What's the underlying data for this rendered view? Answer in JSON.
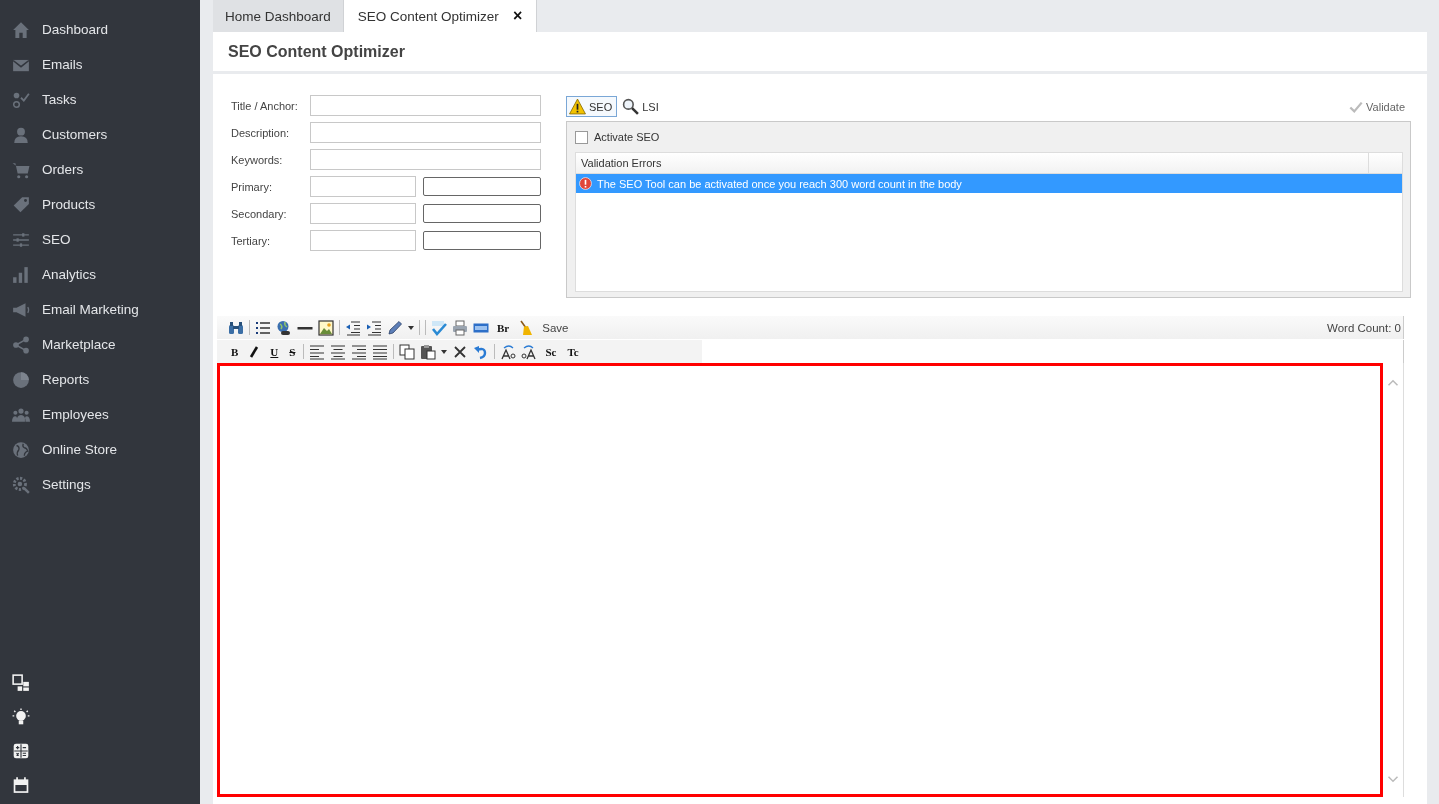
{
  "sidebar": {
    "items": [
      {
        "label": "Dashboard"
      },
      {
        "label": "Emails"
      },
      {
        "label": "Tasks"
      },
      {
        "label": "Customers"
      },
      {
        "label": "Orders"
      },
      {
        "label": "Products"
      },
      {
        "label": "SEO"
      },
      {
        "label": "Analytics"
      },
      {
        "label": "Email Marketing"
      },
      {
        "label": "Marketplace"
      },
      {
        "label": "Reports"
      },
      {
        "label": "Employees"
      },
      {
        "label": "Online Store"
      },
      {
        "label": "Settings"
      }
    ]
  },
  "tabs": [
    {
      "label": "Home Dashboard",
      "selected": false
    },
    {
      "label": "SEO Content Optimizer",
      "selected": true,
      "close": "×"
    }
  ],
  "page_title": "SEO Content Optimizer",
  "form": {
    "fields": [
      {
        "label": "Title / Anchor:",
        "kind": "single"
      },
      {
        "label": "Description:",
        "kind": "single"
      },
      {
        "label": "Keywords:",
        "kind": "single"
      },
      {
        "label": "Primary:",
        "kind": "pair"
      },
      {
        "label": "Secondary:",
        "kind": "pair"
      },
      {
        "label": "Tertiary:",
        "kind": "pair"
      }
    ]
  },
  "seo_panel": {
    "tabs": [
      {
        "label": "SEO",
        "selected": true
      },
      {
        "label": "LSI",
        "selected": false
      }
    ],
    "validate": {
      "label": "Validate",
      "disabled": true
    },
    "activate": {
      "label": "Activate SEO",
      "checked": false
    },
    "grid": {
      "columns": [
        "Validation Errors"
      ],
      "rows": [
        {
          "message": "The SEO Tool can be activated once you reach 300 word count in the body",
          "selected": true
        }
      ]
    }
  },
  "editor": {
    "toolbar": [
      [
        {
          "kind": "icon"
        },
        {
          "kind": "separator"
        },
        {
          "kind": "icon"
        },
        {
          "kind": "icon"
        },
        {
          "kind": "icon"
        },
        {
          "kind": "icon"
        },
        {
          "kind": "separator"
        },
        {
          "kind": "icon"
        },
        {
          "kind": "icon"
        },
        {
          "kind": "icon"
        },
        {
          "kind": "caret"
        },
        {
          "kind": "separator"
        },
        {
          "kind": "separator"
        },
        {
          "kind": "icon"
        },
        {
          "kind": "icon"
        },
        {
          "kind": "icon"
        },
        {
          "kind": "text",
          "text": "Br"
        },
        {
          "kind": "icon"
        },
        {
          "kind": "button",
          "text": "Save"
        }
      ],
      [
        {
          "kind": "text",
          "text": "B"
        },
        {
          "kind": "icon"
        },
        {
          "kind": "underlined",
          "text": "U"
        },
        {
          "kind": "struck",
          "text": "S"
        },
        {
          "kind": "separator"
        },
        {
          "kind": "icon"
        },
        {
          "kind": "icon"
        },
        {
          "kind": "icon"
        },
        {
          "kind": "icon"
        },
        {
          "kind": "separator"
        },
        {
          "kind": "icon"
        },
        {
          "kind": "icon"
        },
        {
          "kind": "caret"
        },
        {
          "kind": "icon"
        },
        {
          "kind": "icon"
        },
        {
          "kind": "separator"
        },
        {
          "kind": "icon"
        },
        {
          "kind": "icon"
        },
        {
          "kind": "text",
          "text": "Sc"
        },
        {
          "kind": "text",
          "text": "Tc"
        }
      ]
    ],
    "word_count": "Word Count: 0"
  }
}
